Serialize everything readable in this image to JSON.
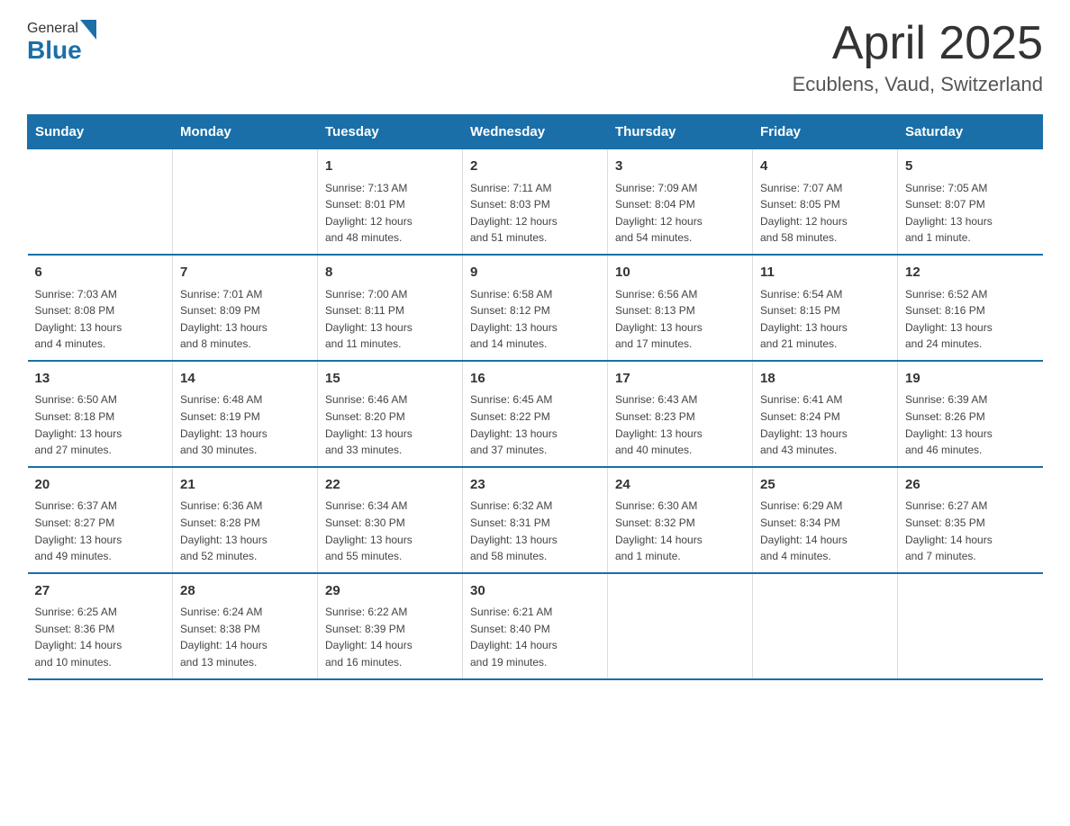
{
  "header": {
    "logo_general": "General",
    "logo_blue": "Blue",
    "title": "April 2025",
    "subtitle": "Ecublens, Vaud, Switzerland"
  },
  "days_of_week": [
    "Sunday",
    "Monday",
    "Tuesday",
    "Wednesday",
    "Thursday",
    "Friday",
    "Saturday"
  ],
  "weeks": [
    [
      {
        "day": "",
        "info": ""
      },
      {
        "day": "",
        "info": ""
      },
      {
        "day": "1",
        "info": "Sunrise: 7:13 AM\nSunset: 8:01 PM\nDaylight: 12 hours\nand 48 minutes."
      },
      {
        "day": "2",
        "info": "Sunrise: 7:11 AM\nSunset: 8:03 PM\nDaylight: 12 hours\nand 51 minutes."
      },
      {
        "day": "3",
        "info": "Sunrise: 7:09 AM\nSunset: 8:04 PM\nDaylight: 12 hours\nand 54 minutes."
      },
      {
        "day": "4",
        "info": "Sunrise: 7:07 AM\nSunset: 8:05 PM\nDaylight: 12 hours\nand 58 minutes."
      },
      {
        "day": "5",
        "info": "Sunrise: 7:05 AM\nSunset: 8:07 PM\nDaylight: 13 hours\nand 1 minute."
      }
    ],
    [
      {
        "day": "6",
        "info": "Sunrise: 7:03 AM\nSunset: 8:08 PM\nDaylight: 13 hours\nand 4 minutes."
      },
      {
        "day": "7",
        "info": "Sunrise: 7:01 AM\nSunset: 8:09 PM\nDaylight: 13 hours\nand 8 minutes."
      },
      {
        "day": "8",
        "info": "Sunrise: 7:00 AM\nSunset: 8:11 PM\nDaylight: 13 hours\nand 11 minutes."
      },
      {
        "day": "9",
        "info": "Sunrise: 6:58 AM\nSunset: 8:12 PM\nDaylight: 13 hours\nand 14 minutes."
      },
      {
        "day": "10",
        "info": "Sunrise: 6:56 AM\nSunset: 8:13 PM\nDaylight: 13 hours\nand 17 minutes."
      },
      {
        "day": "11",
        "info": "Sunrise: 6:54 AM\nSunset: 8:15 PM\nDaylight: 13 hours\nand 21 minutes."
      },
      {
        "day": "12",
        "info": "Sunrise: 6:52 AM\nSunset: 8:16 PM\nDaylight: 13 hours\nand 24 minutes."
      }
    ],
    [
      {
        "day": "13",
        "info": "Sunrise: 6:50 AM\nSunset: 8:18 PM\nDaylight: 13 hours\nand 27 minutes."
      },
      {
        "day": "14",
        "info": "Sunrise: 6:48 AM\nSunset: 8:19 PM\nDaylight: 13 hours\nand 30 minutes."
      },
      {
        "day": "15",
        "info": "Sunrise: 6:46 AM\nSunset: 8:20 PM\nDaylight: 13 hours\nand 33 minutes."
      },
      {
        "day": "16",
        "info": "Sunrise: 6:45 AM\nSunset: 8:22 PM\nDaylight: 13 hours\nand 37 minutes."
      },
      {
        "day": "17",
        "info": "Sunrise: 6:43 AM\nSunset: 8:23 PM\nDaylight: 13 hours\nand 40 minutes."
      },
      {
        "day": "18",
        "info": "Sunrise: 6:41 AM\nSunset: 8:24 PM\nDaylight: 13 hours\nand 43 minutes."
      },
      {
        "day": "19",
        "info": "Sunrise: 6:39 AM\nSunset: 8:26 PM\nDaylight: 13 hours\nand 46 minutes."
      }
    ],
    [
      {
        "day": "20",
        "info": "Sunrise: 6:37 AM\nSunset: 8:27 PM\nDaylight: 13 hours\nand 49 minutes."
      },
      {
        "day": "21",
        "info": "Sunrise: 6:36 AM\nSunset: 8:28 PM\nDaylight: 13 hours\nand 52 minutes."
      },
      {
        "day": "22",
        "info": "Sunrise: 6:34 AM\nSunset: 8:30 PM\nDaylight: 13 hours\nand 55 minutes."
      },
      {
        "day": "23",
        "info": "Sunrise: 6:32 AM\nSunset: 8:31 PM\nDaylight: 13 hours\nand 58 minutes."
      },
      {
        "day": "24",
        "info": "Sunrise: 6:30 AM\nSunset: 8:32 PM\nDaylight: 14 hours\nand 1 minute."
      },
      {
        "day": "25",
        "info": "Sunrise: 6:29 AM\nSunset: 8:34 PM\nDaylight: 14 hours\nand 4 minutes."
      },
      {
        "day": "26",
        "info": "Sunrise: 6:27 AM\nSunset: 8:35 PM\nDaylight: 14 hours\nand 7 minutes."
      }
    ],
    [
      {
        "day": "27",
        "info": "Sunrise: 6:25 AM\nSunset: 8:36 PM\nDaylight: 14 hours\nand 10 minutes."
      },
      {
        "day": "28",
        "info": "Sunrise: 6:24 AM\nSunset: 8:38 PM\nDaylight: 14 hours\nand 13 minutes."
      },
      {
        "day": "29",
        "info": "Sunrise: 6:22 AM\nSunset: 8:39 PM\nDaylight: 14 hours\nand 16 minutes."
      },
      {
        "day": "30",
        "info": "Sunrise: 6:21 AM\nSunset: 8:40 PM\nDaylight: 14 hours\nand 19 minutes."
      },
      {
        "day": "",
        "info": ""
      },
      {
        "day": "",
        "info": ""
      },
      {
        "day": "",
        "info": ""
      }
    ]
  ]
}
